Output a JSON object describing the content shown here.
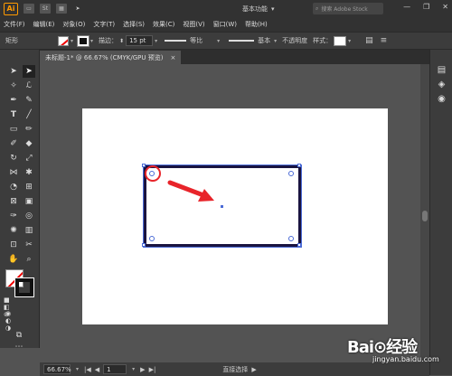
{
  "titlebar": {
    "logo": "Ai",
    "icon_st": "St",
    "workspace": "基本功能",
    "search_placeholder": "搜索 Adobe Stock"
  },
  "menubar": {
    "items": [
      "文件(F)",
      "编辑(E)",
      "对象(O)",
      "文字(T)",
      "选择(S)",
      "效果(C)",
      "视图(V)",
      "窗口(W)",
      "帮助(H)"
    ]
  },
  "controlbar": {
    "object_type": "矩形",
    "stroke_label": "描边：",
    "stroke_value": "15 pt",
    "profile_label": "等比",
    "brush_label": "基本",
    "opacity_label": "不透明度",
    "style_label": "样式："
  },
  "document": {
    "tab_title": "未标题-1* @ 66.67% (CMYK/GPU 预览)",
    "close_symbol": "×"
  },
  "statusbar": {
    "zoom": "66.67%",
    "artboard_number": "1",
    "tool_name": "直接选择"
  },
  "watermark": {
    "brand": "Bai⊙经验",
    "url": "jingyan.baidu.com"
  },
  "colors": {
    "accent": "#4b6bd6",
    "annotation": "#e8242a",
    "stroke": "#1a1440"
  }
}
